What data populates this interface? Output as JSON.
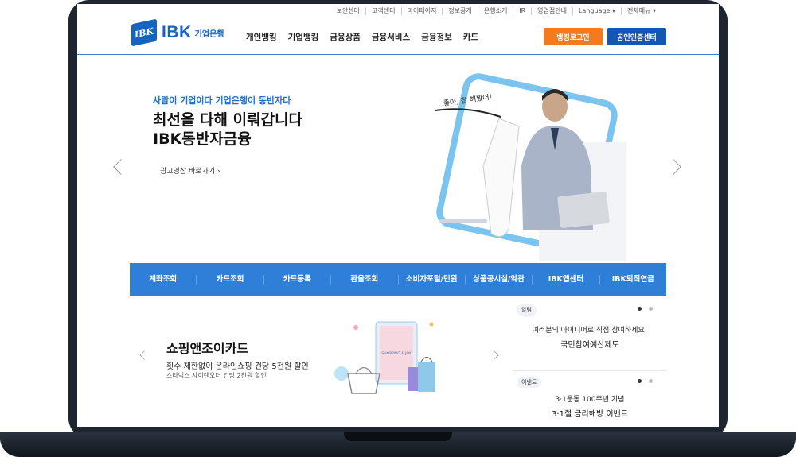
{
  "utility_bar": [
    "보안센터",
    "고객센터",
    "마이페이지",
    "정보공개",
    "은행소개",
    "IR",
    "영업점안내",
    "Language ▾",
    "전체메뉴 ▾"
  ],
  "logo": {
    "mark": "IBK",
    "name": "IBK",
    "sub": "기업은행"
  },
  "gnb": [
    "개인뱅킹",
    "기업뱅킹",
    "금융상품",
    "금융서비스",
    "금융정보",
    "카드"
  ],
  "header_buttons": {
    "login": "뱅킹로그인",
    "cert": "공인인증센터"
  },
  "hero": {
    "subtitle": "사람이 기업이다 기업은행이 동반자다",
    "title_line1": "최선을 다해 이뤄갑니다",
    "title_line2": "IBK동반자금융",
    "link": "광고영상 바로가기 ›",
    "scroll_text": "좋아, 잘 해봤어!"
  },
  "quick_menu": [
    "계좌조회",
    "카드조회",
    "카드등록",
    "환율조회",
    "소비자포털/민원",
    "상품공시실/약관",
    "IBK앱센터",
    "IBK퇴직연금"
  ],
  "promo": {
    "title": "쇼핑앤조이카드",
    "desc": "횟수 제한없이 온라인쇼핑 건당 5천원 할인",
    "note": "스타벅스 사이렌오더 건당 2천원 할인",
    "card_text": "SHOPPING & JOY"
  },
  "notices": [
    {
      "badge": "알림",
      "line1": "여러분의 아이디어로 직접 참여하세요!",
      "line2": "국민참여예산제도"
    },
    {
      "badge": "이벤트",
      "line1": "3·1운동 100주년 기념",
      "line2": "3·1절 금리해방 이벤트"
    }
  ],
  "colors": {
    "brand_blue": "#1565c0",
    "quick_bar": "#2f7fd8",
    "login_orange": "#f47a20",
    "cert_blue": "#1456b5",
    "hero_sub": "#1e6fd9"
  },
  "icons": {
    "prev": "chevron-left-icon",
    "next": "chevron-right-icon"
  }
}
